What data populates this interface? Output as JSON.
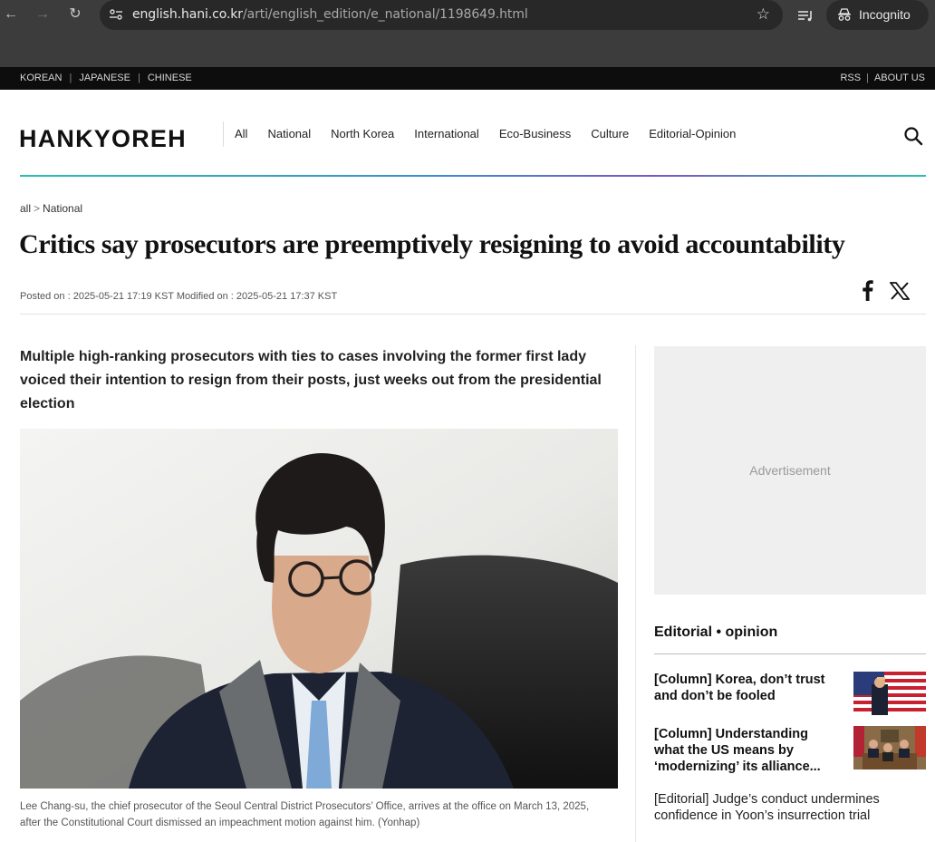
{
  "browser": {
    "url_host": "english.hani.co.kr",
    "url_path": "/arti/english_edition/e_national/1198649.html",
    "incognito_label": "Incognito"
  },
  "lang_bar": {
    "languages": [
      "KOREAN",
      "JAPANESE",
      "CHINESE"
    ],
    "utility": [
      "RSS",
      "ABOUT US"
    ]
  },
  "header": {
    "logo": "HANKYOREH",
    "nav": [
      "All",
      "National",
      "North Korea",
      "International",
      "Eco-Business",
      "Culture",
      "Editorial-Opinion"
    ]
  },
  "article": {
    "breadcrumb": [
      "all",
      "National"
    ],
    "breadcrumb_sep": ">",
    "headline": "Critics say prosecutors are preemptively resigning to avoid accountability",
    "dates": "Posted on : 2025-05-21 17:19 KST Modified on : 2025-05-21 17:37 KST",
    "subhead": "Multiple high-ranking prosecutors with ties to cases involving the former first lady voiced their intention to resign from their posts, just weeks out from the presidential election",
    "caption": "Lee Chang-su, the chief prosecutor of the Seoul Central District Prosecutors’ Office, arrives at the office on March 13, 2025, after the Constitutional Court dismissed an impeachment motion against him. (Yonhap)"
  },
  "sidebar": {
    "ad_label": "Advertisement",
    "heading": "Editorial • opinion",
    "items": [
      {
        "title": "[Column] Korea, don’t trust and don’t be fooled"
      },
      {
        "title": "[Column] Understanding what the US means by ‘modernizing’ its alliance..."
      },
      {
        "title": "[Editorial] Judge’s conduct undermines confidence in Yoon’s insurrection trial"
      }
    ]
  },
  "colors": {
    "chrome_bg": "#3c3c3c",
    "lang_bar_bg": "#0d0d0d",
    "rule_gradient_start": "#2bbfb5",
    "rule_gradient_mid": "#7a55c7"
  }
}
